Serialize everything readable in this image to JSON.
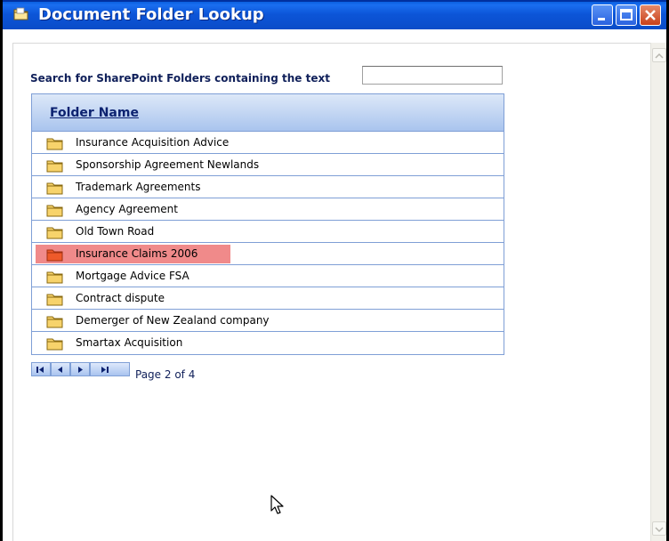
{
  "window": {
    "title": "Document Folder Lookup",
    "accent": "#0a4cc8"
  },
  "search": {
    "label": "Search for SharePoint Folders containing the text",
    "value": "",
    "placeholder": ""
  },
  "grid": {
    "header": "Folder Name",
    "selected_color": "#f08a8a",
    "rows": [
      {
        "label": "Insurance Acquisition Advice",
        "selected": false
      },
      {
        "label": "Sponsorship Agreement Newlands",
        "selected": false
      },
      {
        "label": "Trademark Agreements",
        "selected": false
      },
      {
        "label": "Agency Agreement",
        "selected": false
      },
      {
        "label": "Old Town Road",
        "selected": false
      },
      {
        "label": "Insurance Claims 2006",
        "selected": true
      },
      {
        "label": "Mortgage Advice FSA",
        "selected": false
      },
      {
        "label": "Contract dispute",
        "selected": false
      },
      {
        "label": "Demerger of New Zealand company",
        "selected": false
      },
      {
        "label": "Smartax Acquisition",
        "selected": false
      }
    ]
  },
  "pager": {
    "text": "Page 2 of 4",
    "buttons": [
      "first-page-icon",
      "prev-page-icon",
      "next-page-icon",
      "last-page-icon"
    ]
  }
}
